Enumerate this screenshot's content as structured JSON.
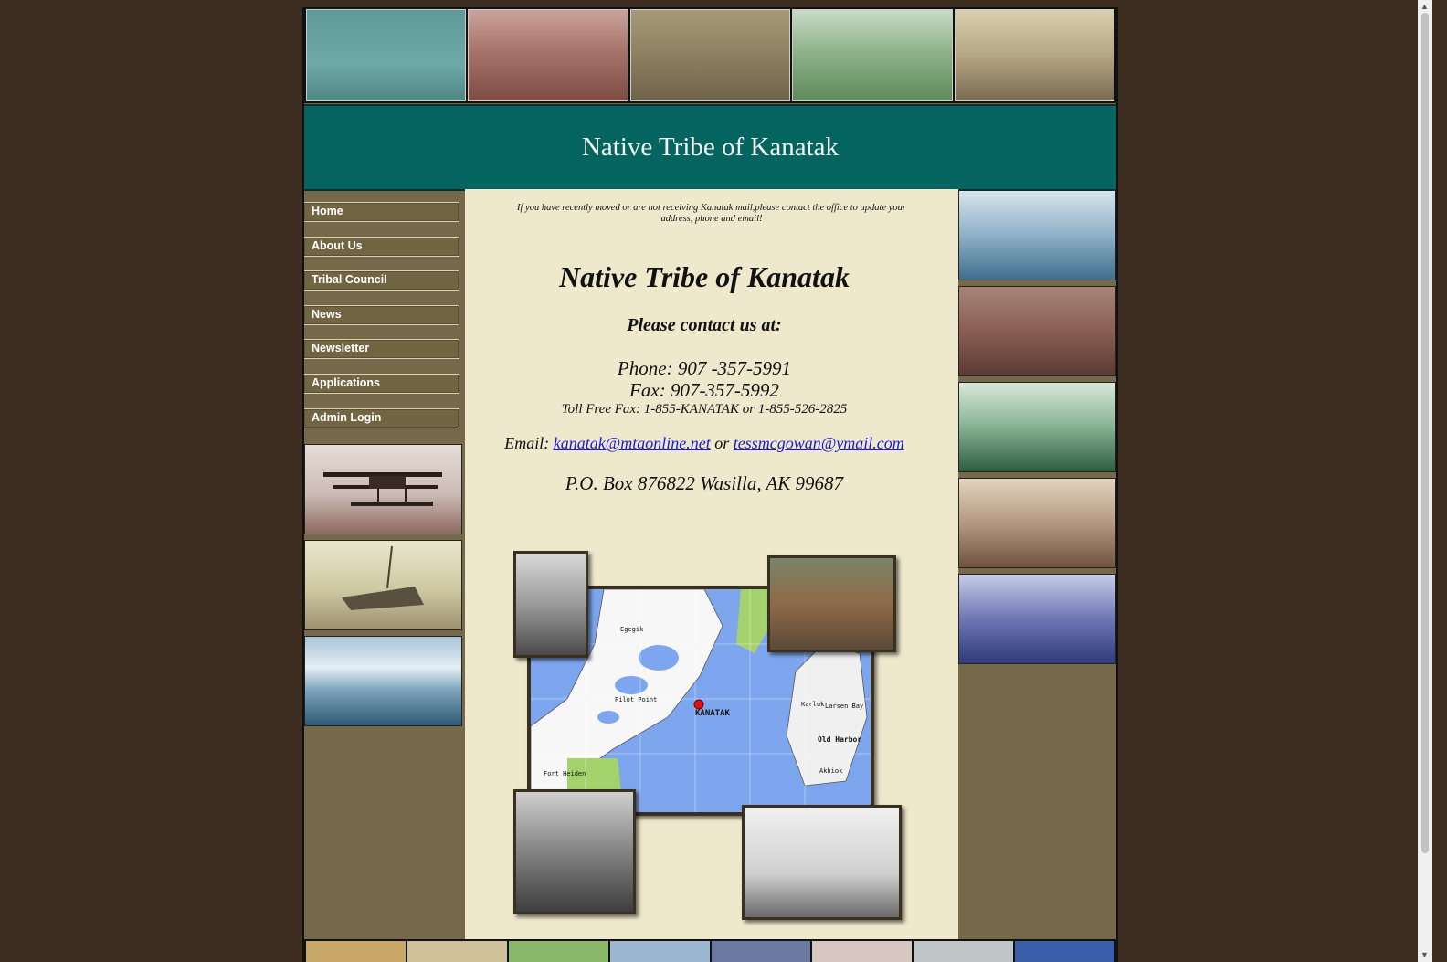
{
  "banner": {
    "title": "Native Tribe of Kanatak"
  },
  "nav": {
    "items": [
      {
        "label": "Home"
      },
      {
        "label": "About Us"
      },
      {
        "label": "Tribal Council"
      },
      {
        "label": "News"
      },
      {
        "label": "Newsletter"
      },
      {
        "label": "Applications"
      },
      {
        "label": "Admin Login"
      }
    ]
  },
  "content": {
    "notice": "If you have recently moved or are not receiving Kanatak mail,please contact the office to update your address, phone and email!",
    "title": "Native Tribe of Kanatak",
    "contact_heading": "Please contact us at:",
    "phone": "Phone: 907 -357-5991",
    "fax": "Fax: 907-357-5992",
    "toll_free": "Toll Free Fax: 1-855-KANATAK or 1-855-526-2825",
    "email_prefix": "Email:",
    "email_1": "kanatak@mtaonline.net",
    "email_or": "or",
    "email_2": "tessmcgowan@ymail.com",
    "po_box": "P.O. Box 876822 Wasilla, AK 99687"
  },
  "map": {
    "labels": {
      "egegik": "Egegik",
      "pilot_point": "Pilot Point",
      "kanatak": "KANATAK",
      "karluk": "Karluk",
      "larsen_bay": "Larsen Bay",
      "old_harbor": "Old Harbor",
      "akhiok": "Akhiok",
      "fort_heiden": "Fort Heiden"
    }
  },
  "colors": {
    "background": "#3d2c20",
    "frame": "#76694a",
    "banner": "#046560",
    "content_bg": "#eee8cc",
    "link": "#1a1ad8"
  }
}
